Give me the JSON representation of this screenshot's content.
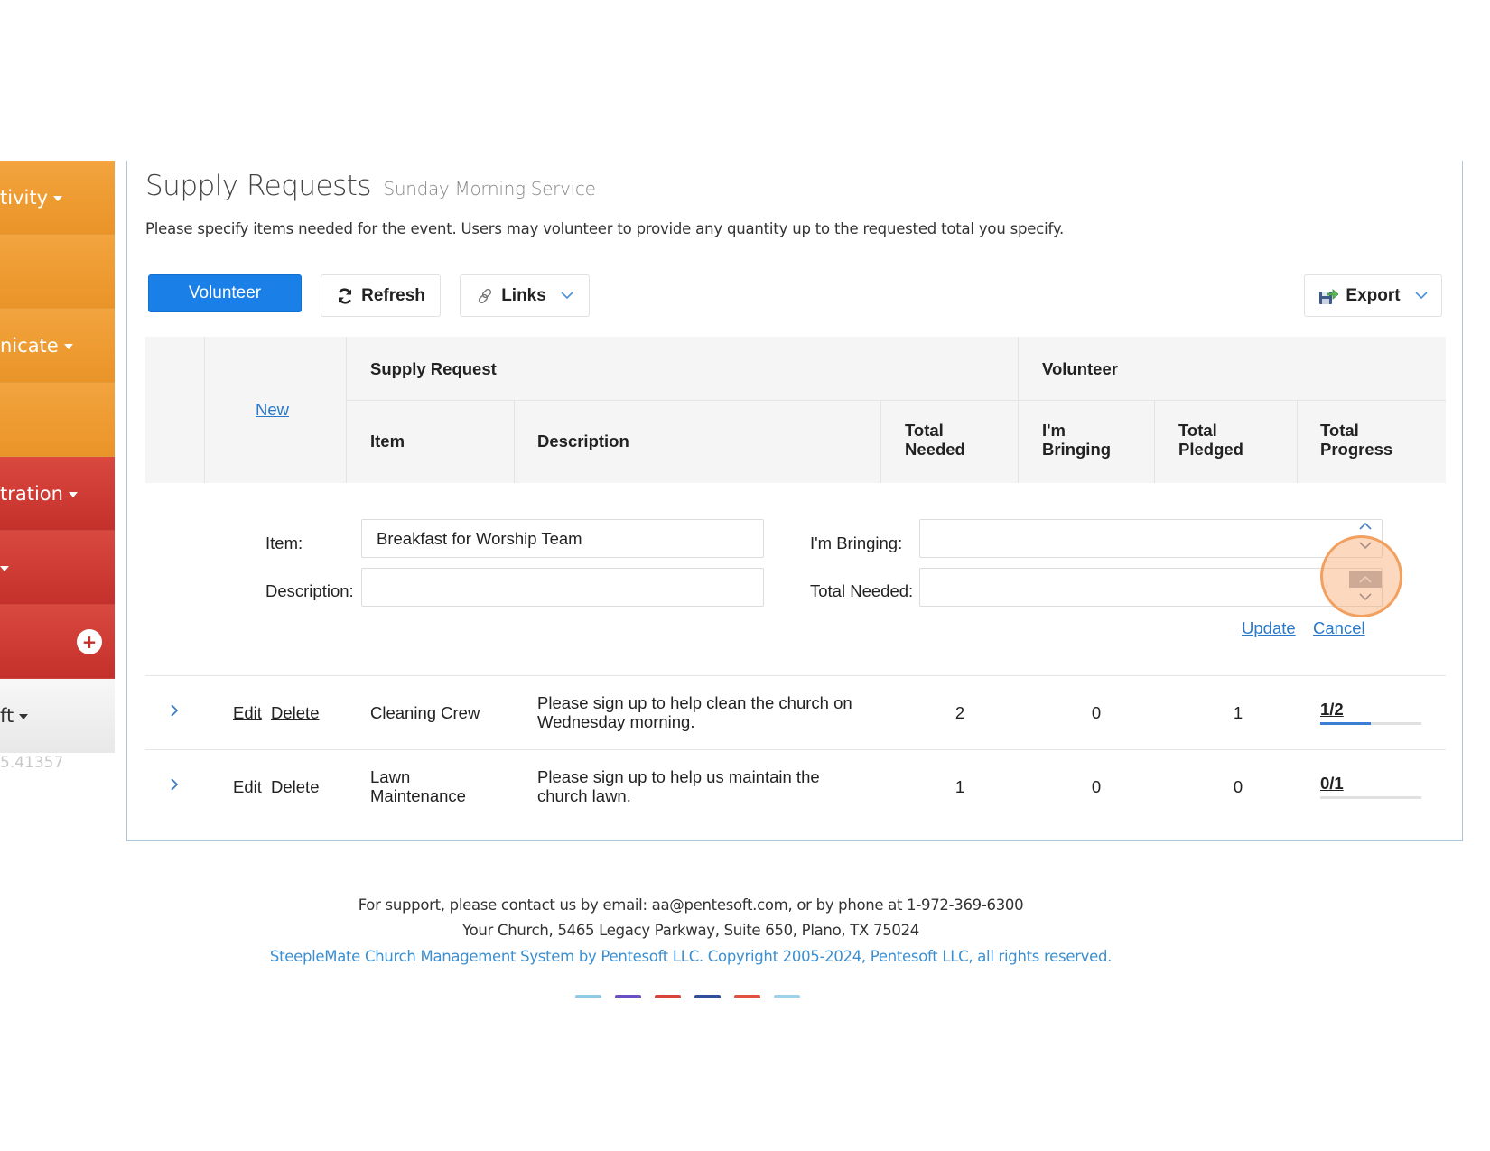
{
  "sidebar": {
    "items": [
      {
        "label": "tivity",
        "has_caret": true,
        "color": "orange"
      },
      {
        "label": "",
        "has_caret": false,
        "color": "orange"
      },
      {
        "label": "nicate",
        "has_caret": true,
        "color": "orange"
      },
      {
        "label": "",
        "has_caret": false,
        "color": "orange"
      },
      {
        "label": "tration",
        "has_caret": true,
        "color": "red"
      },
      {
        "label": "",
        "has_caret": true,
        "color": "red"
      },
      {
        "label": "",
        "has_caret": false,
        "color": "red",
        "icon": "plus-circle-icon"
      },
      {
        "label": "ft",
        "has_caret": true,
        "color": "grey"
      }
    ],
    "version": "5.41357"
  },
  "header": {
    "title": "Supply Requests",
    "subtitle": "Sunday Morning Service",
    "description": "Please specify items needed for the event. Users may volunteer to provide any quantity up to the requested total you specify."
  },
  "toolbar": {
    "volunteer_label": "Volunteer",
    "refresh_label": "Refresh",
    "links_label": "Links",
    "export_label": "Export"
  },
  "table": {
    "new_link": "New",
    "group_headers": {
      "supply_request": "Supply Request",
      "volunteer": "Volunteer"
    },
    "columns": {
      "item": "Item",
      "description": "Description",
      "total_needed_1": "Total",
      "total_needed_2": "Needed",
      "im_bringing_1": "I'm",
      "im_bringing_2": "Bringing",
      "total_pledged_1": "Total",
      "total_pledged_2": "Pledged",
      "total_progress_1": "Total",
      "total_progress_2": "Progress"
    },
    "edit_form": {
      "item_label": "Item:",
      "item_value": "Breakfast for Worship Team",
      "description_label": "Description:",
      "description_value": "",
      "im_bringing_label": "I'm Bringing:",
      "im_bringing_value": "",
      "total_needed_label": "Total Needed:",
      "total_needed_value": "",
      "update_label": "Update",
      "cancel_label": "Cancel"
    },
    "rows": [
      {
        "edit": "Edit",
        "delete": "Delete",
        "item": "Cleaning Crew",
        "description_line1": "Please sign up to help clean the church on",
        "description_line2": "Wednesday morning.",
        "total_needed": "2",
        "im_bringing": "0",
        "total_pledged": "1",
        "progress_label": "1/2",
        "progress_fraction": 0.5
      },
      {
        "edit": "Edit",
        "delete": "Delete",
        "item_line1": "Lawn",
        "item_line2": "Maintenance",
        "description_line1": "Please sign up to help us maintain the",
        "description_line2": "church lawn.",
        "total_needed": "1",
        "im_bringing": "0",
        "total_pledged": "0",
        "progress_label": "0/1",
        "progress_fraction": 0
      }
    ]
  },
  "footer": {
    "support": "For support, please contact us by email: aa@pentesoft.com, or by phone at 1-972-369-6300",
    "address": "Your Church, 5465 Legacy Parkway, Suite 650, Plano, TX 75024",
    "copyright": "SteepleMate Church Management System by Pentesoft LLC. Copyright 2005-2024, Pentesoft LLC, all rights reserved.",
    "social_colors": [
      "#8fcbe6",
      "#6a4fc4",
      "#d9443a",
      "#2f4f9a",
      "#e0523f",
      "#9ed2ea"
    ]
  },
  "colors": {
    "primary": "#1a7fe6",
    "link": "#2a78c8",
    "sidebar_orange": "#ea9428",
    "sidebar_red": "#c4302b",
    "progress": "#3b7fd4",
    "highlight": "#f0a060"
  }
}
